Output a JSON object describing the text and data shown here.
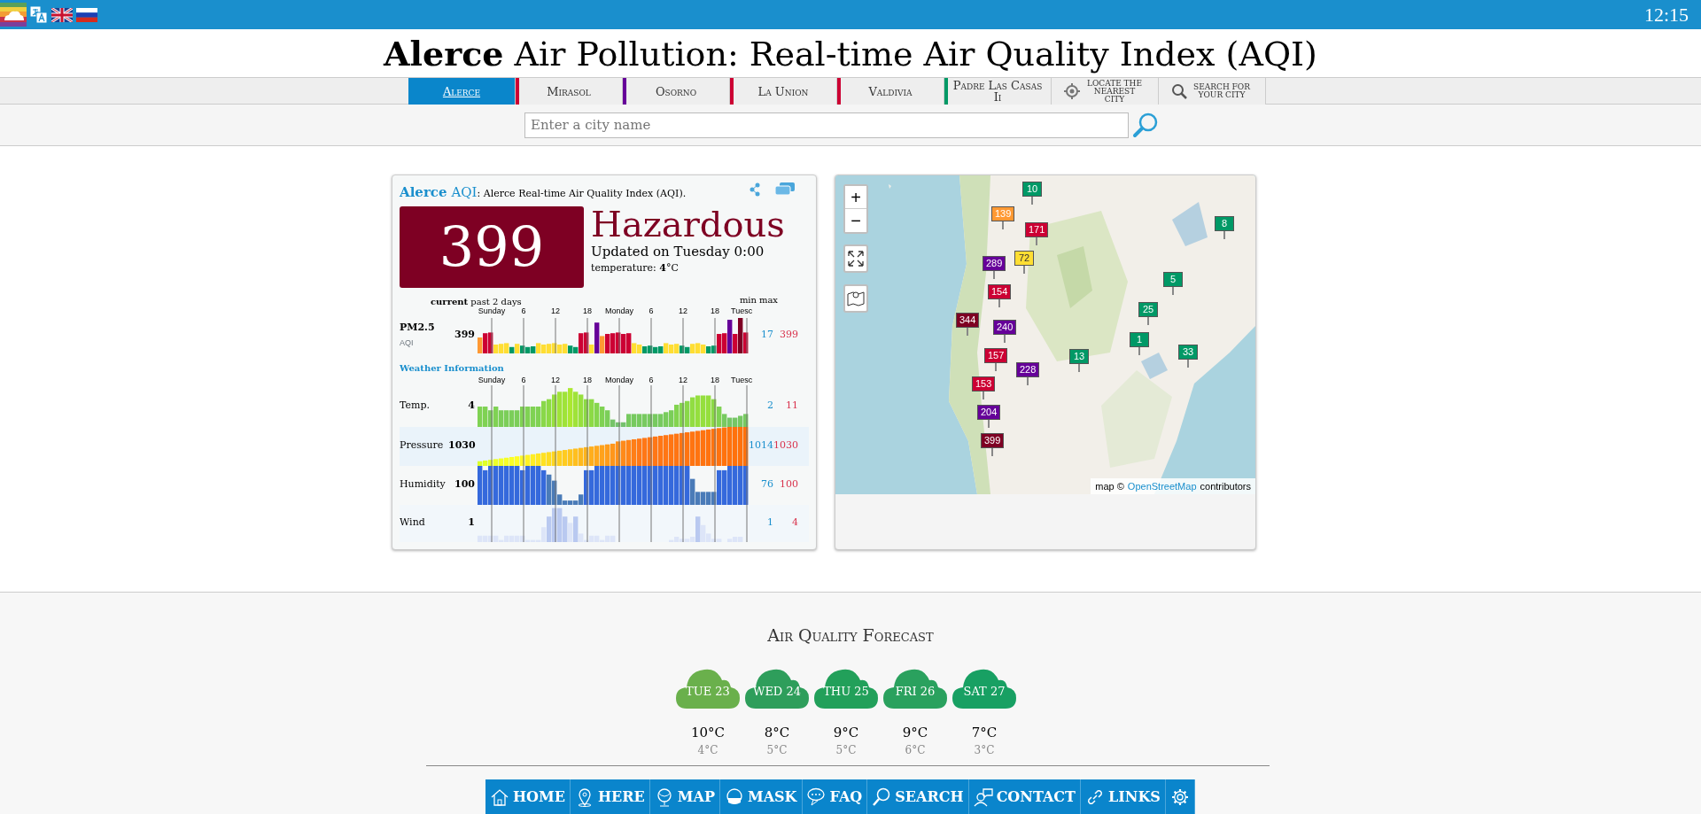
{
  "top_bar": {
    "clock": "12:15"
  },
  "title": {
    "city": "Alerce",
    "rest": "Air Pollution: Real-time Air Quality Index (AQI)"
  },
  "tabs": [
    {
      "label": "Alerce",
      "kind": "city",
      "selected": true
    },
    {
      "label": "Mirasol",
      "kind": "city",
      "selected": false,
      "color": "#cc0033"
    },
    {
      "label": "Osorno",
      "kind": "city",
      "selected": false,
      "color": "#660099"
    },
    {
      "label": "La Union",
      "kind": "city",
      "selected": false,
      "color": "#cc0033"
    },
    {
      "label": "Valdivia",
      "kind": "city",
      "selected": false,
      "color": "#cc0033"
    },
    {
      "label": "Padre Las Casas Ii",
      "kind": "city",
      "selected": false,
      "color": "#009966"
    },
    {
      "label": "LOCATE THE NEAREST CITY",
      "kind": "locate",
      "selected": false
    },
    {
      "label": "SEARCH FOR YOUR CITY",
      "kind": "search",
      "selected": false
    }
  ],
  "search": {
    "placeholder": "Enter a city name"
  },
  "aqi_card": {
    "city": "Alerce",
    "aqi_link": "AQI",
    "description": ": Alerce Real-time Air Quality Index (AQI).",
    "aqi": "399",
    "level": "Hazardous",
    "color": "#7e0023",
    "updated": "Updated on Tuesday 0:00",
    "temperature": "temperature: **4**°C"
  },
  "history": {
    "current_label": "current",
    "period_label": "past 2 days",
    "min_label": "min",
    "max_label": "max",
    "ticks": [
      "Sunday",
      "6",
      "12",
      "18",
      "Monday",
      "6",
      "12",
      "18",
      "Tuesc"
    ]
  },
  "pollutant": {
    "name": "PM2.5",
    "unit": "AQI",
    "current": "399",
    "min": "17",
    "max": "399"
  },
  "weather_title": "Weather Information",
  "weather_ticks": [
    "Sunday",
    "6",
    "12",
    "18",
    "Monday",
    "6",
    "12",
    "18",
    "Tuesc"
  ],
  "weather": [
    {
      "name": "Temp.",
      "kind": "temp",
      "current": "4",
      "min": "2",
      "max": "11"
    },
    {
      "name": "Pressure",
      "kind": "pressure",
      "current": "1030",
      "min": "1014",
      "max": "1030"
    },
    {
      "name": "Humidity",
      "kind": "humidity",
      "current": "100",
      "min": "76",
      "max": "100"
    },
    {
      "name": "Wind",
      "kind": "wind",
      "current": "1",
      "min": "1",
      "max": "4"
    }
  ],
  "map": {
    "zoom_in": "+",
    "zoom_out": "−",
    "markers": [
      {
        "value": "10",
        "color": "#009966"
      },
      {
        "value": "139",
        "color": "#ff9933"
      },
      {
        "value": "171",
        "color": "#cc0033"
      },
      {
        "value": "72",
        "color": "#ffde33"
      },
      {
        "value": "289",
        "color": "#660099"
      },
      {
        "value": "154",
        "color": "#cc0033"
      },
      {
        "value": "344",
        "color": "#7e0023"
      },
      {
        "value": "240",
        "color": "#660099"
      },
      {
        "value": "157",
        "color": "#cc0033"
      },
      {
        "value": "228",
        "color": "#660099"
      },
      {
        "value": "153",
        "color": "#cc0033"
      },
      {
        "value": "204",
        "color": "#660099"
      },
      {
        "value": "399",
        "color": "#7e0023"
      },
      {
        "value": "13",
        "color": "#009966"
      },
      {
        "value": "5",
        "color": "#009966"
      },
      {
        "value": "25",
        "color": "#009966"
      },
      {
        "value": "1",
        "color": "#009966"
      },
      {
        "value": "8",
        "color": "#009966"
      },
      {
        "value": "33",
        "color": "#009966"
      }
    ],
    "attribution": {
      "prefix": "map ©",
      "link": "OpenStreetMap",
      "suffix": "contributors"
    }
  },
  "forecast": {
    "title": "Air Quality Forecast",
    "days": [
      {
        "label": "TUE 23",
        "color": "#6ab04c",
        "high": "10°C",
        "low": "4°C"
      },
      {
        "label": "WED 24",
        "color": "#2e9e5b",
        "high": "8°C",
        "low": "5°C"
      },
      {
        "label": "THU 25",
        "color": "#22a05a",
        "high": "9°C",
        "low": "5°C"
      },
      {
        "label": "FRI 26",
        "color": "#2aa15e",
        "high": "9°C",
        "low": "6°C"
      },
      {
        "label": "SAT 27",
        "color": "#18a063",
        "high": "7°C",
        "low": "3°C"
      }
    ]
  },
  "bottom_nav": [
    {
      "label": "HOME",
      "kind": "home"
    },
    {
      "label": "HERE",
      "kind": "here"
    },
    {
      "label": "MAP",
      "kind": "map"
    },
    {
      "label": "MASK",
      "kind": "mask"
    },
    {
      "label": "FAQ",
      "kind": "faq"
    },
    {
      "label": "SEARCH",
      "kind": "search"
    },
    {
      "label": "CONTACT",
      "kind": "contact"
    },
    {
      "label": "LINKS",
      "kind": "links"
    },
    {
      "kind": "settings"
    }
  ]
}
